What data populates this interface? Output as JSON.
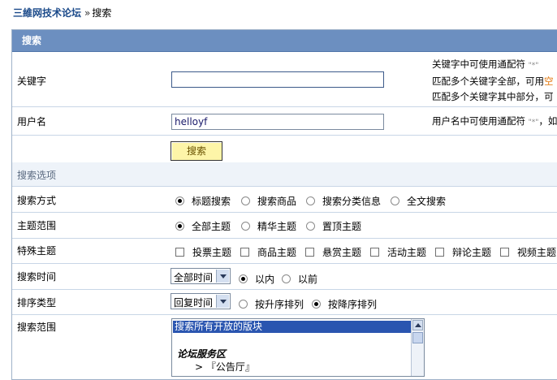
{
  "breadcrumb": {
    "home": "三維网技术论坛",
    "sep": "»",
    "current": "搜索"
  },
  "panel": {
    "title": "搜索"
  },
  "keyword": {
    "label": "关键字",
    "value": "",
    "tips": [
      {
        "text": "关键字中可使用通配符",
        "wildcard": "\"*\""
      },
      {
        "text": "匹配多个关键字全部，可用",
        "highlight": "空"
      },
      {
        "text": "匹配多个关键字其中部分，可"
      }
    ]
  },
  "username": {
    "label": "用户名",
    "value": "helloyf",
    "tip": "用户名中可使用通配符",
    "wildcard": "\"*\"",
    "tip_tail": "，如"
  },
  "search_button": {
    "label": "搜索"
  },
  "options_section": {
    "title": "搜索选项"
  },
  "search_mode": {
    "label": "搜索方式",
    "options": [
      "标题搜索",
      "搜索商品",
      "搜索分类信息",
      "全文搜索"
    ],
    "selected": 0
  },
  "topic_range": {
    "label": "主题范围",
    "options": [
      "全部主题",
      "精华主题",
      "置顶主题"
    ],
    "selected": 0
  },
  "special_topic": {
    "label": "特殊主题",
    "options": [
      "投票主题",
      "商品主题",
      "悬赏主题",
      "活动主题",
      "辩论主题",
      "视频主题"
    ]
  },
  "search_time": {
    "label": "搜索时间",
    "select_value": "全部时间",
    "options": [
      "以内",
      "以前"
    ],
    "selected": 0
  },
  "sort_type": {
    "label": "排序类型",
    "select_value": "回复时间",
    "options": [
      "按升序排列",
      "按降序排列"
    ],
    "selected": 1
  },
  "search_scope": {
    "label": "搜索范围",
    "selected_item": "搜索所有开放的版块",
    "group": "论坛服务区",
    "item": "> 『公告厅』"
  }
}
